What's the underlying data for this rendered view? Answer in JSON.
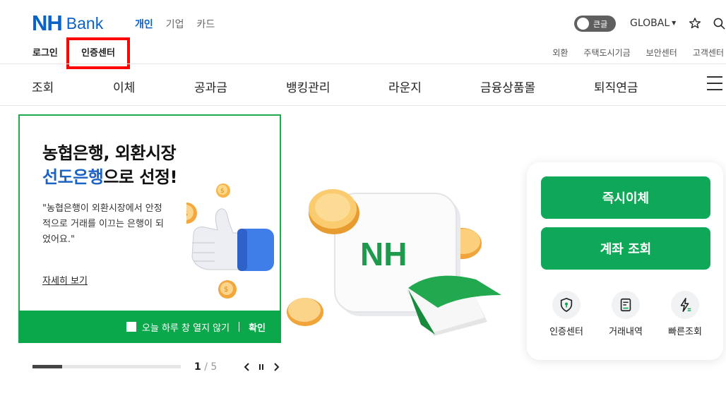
{
  "header": {
    "logo_nh": "NH",
    "logo_bank": "Bank",
    "tabs": [
      {
        "label": "개인",
        "active": true
      },
      {
        "label": "기업",
        "active": false
      },
      {
        "label": "카드",
        "active": false
      }
    ],
    "big_text_label": "큰글",
    "global_label": "GLOBAL",
    "login_label": "로그인",
    "cert_label": "인증센터",
    "util_links": [
      "외환",
      "주택도시기금",
      "보안센터",
      "고객센터"
    ]
  },
  "gnb": [
    "조회",
    "이체",
    "공과금",
    "뱅킹관리",
    "라운지",
    "금융상품몰",
    "퇴직연금"
  ],
  "banner": {
    "title_line1": "농협은행, 외환시장",
    "title_highlight": "선도은행",
    "title_rest": "으로 선정!",
    "desc": "\"농협은행이 외환시장에서 안정적으로 거래를 이끄는 은행이 되었어요.\"",
    "more_label": "자세히 보기",
    "no_show_label": "오늘 하루 창 열지 않기",
    "confirm_label": "확인"
  },
  "pager": {
    "current": "1",
    "separator": "/",
    "total": "5",
    "progress": 0.2
  },
  "illustration": {
    "card_text": "NH"
  },
  "quick": {
    "primary_buttons": [
      "즉시이체",
      "계좌 조회"
    ],
    "icons": [
      {
        "label": "인증센터",
        "icon": "shield-icon"
      },
      {
        "label": "거래내역",
        "icon": "receipt-icon"
      },
      {
        "label": "빠른조회",
        "icon": "lightning-icon"
      }
    ]
  },
  "colors": {
    "brand_blue": "#0a62c6",
    "brand_green": "#0fa858",
    "highlight_red": "#ff0000"
  }
}
